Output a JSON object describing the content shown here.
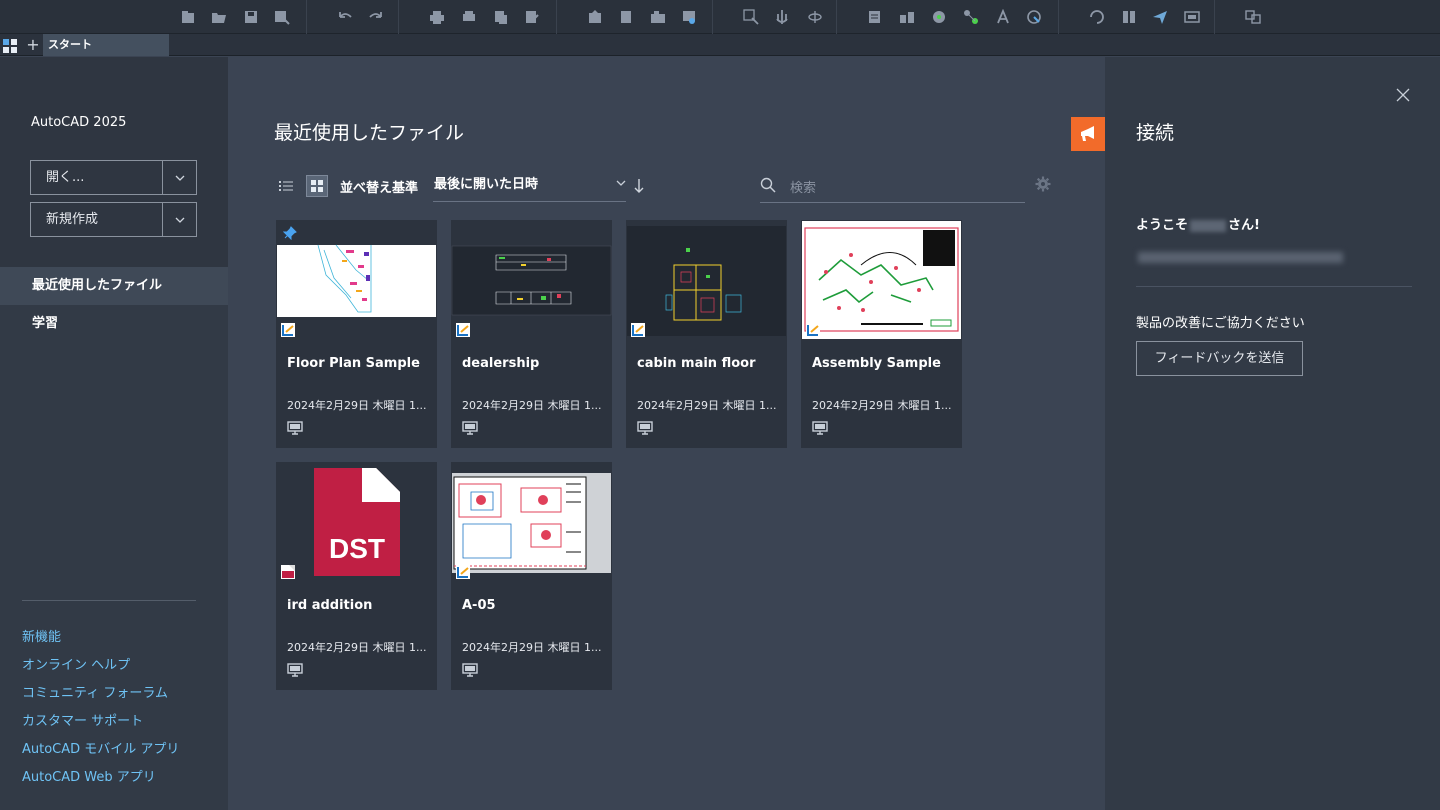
{
  "toolbar": {
    "icons": [
      "new-icon",
      "open-icon",
      "save-icon",
      "save-as-icon",
      "undo-icon",
      "redo-icon",
      "print-icon",
      "plot-icon",
      "publish-icon",
      "edit-icon",
      "import-icon",
      "export-icon",
      "block-icon",
      "image-icon",
      "zoom-icon",
      "pan-icon",
      "orbit-icon",
      "properties-icon",
      "layer-icon",
      "network-icon",
      "share-icon",
      "text-icon",
      "attach-icon",
      "sync-icon",
      "view-icon",
      "send-icon",
      "sheet-icon",
      "compare-icon",
      "clipboard-icon"
    ]
  },
  "tabbar": {
    "plus": "+",
    "active_tab": "スタート"
  },
  "sidebar": {
    "app_name": "AutoCAD 2025",
    "open_label": "開く...",
    "new_label": "新規作成",
    "nav": [
      {
        "label": "最近使用したファイル"
      },
      {
        "label": "学習"
      }
    ],
    "links": [
      {
        "label": "新機能"
      },
      {
        "label": "オンライン ヘルプ"
      },
      {
        "label": "コミュニティ フォーラム"
      },
      {
        "label": "カスタマー サポート"
      },
      {
        "label": "AutoCAD モバイル アプリ"
      },
      {
        "label": "AutoCAD Web アプリ"
      }
    ]
  },
  "main": {
    "title": "最近使用したファイル",
    "sort_label": "並べ替え基準",
    "sort_value": "最後に開いた日時",
    "search_placeholder": "検索",
    "files": [
      {
        "name": "Floor Plan Sample",
        "date": "2024年2月29日 木曜日 1...",
        "file_icon": "dwg-icon",
        "pinned": true
      },
      {
        "name": "dealership",
        "date": "2024年2月29日 木曜日 1...",
        "file_icon": "dwg-icon",
        "pinned": false
      },
      {
        "name": "cabin main floor",
        "date": "2024年2月29日 木曜日 1...",
        "file_icon": "dwg-icon",
        "pinned": false
      },
      {
        "name": "Assembly Sample",
        "date": "2024年2月29日 木曜日 1...",
        "file_icon": "dwg-icon",
        "pinned": false
      },
      {
        "name": "ird addition",
        "date": "2024年2月29日 木曜日 1...",
        "file_icon": "dst-icon",
        "pinned": false,
        "thumb_text": "DST"
      },
      {
        "name": "A-05",
        "date": "2024年2月29日 木曜日 1...",
        "file_icon": "dwg-icon",
        "pinned": false
      }
    ]
  },
  "right": {
    "title": "接続",
    "welcome_prefix": "ようこそ",
    "welcome_suffix": "さん!",
    "improve_text": "製品の改善にご協力ください",
    "feedback_label": "フィードバックを送信"
  },
  "colors": {
    "accent": "#f26b2a",
    "link": "#6fc3f5",
    "pin": "#4aa3f0"
  }
}
